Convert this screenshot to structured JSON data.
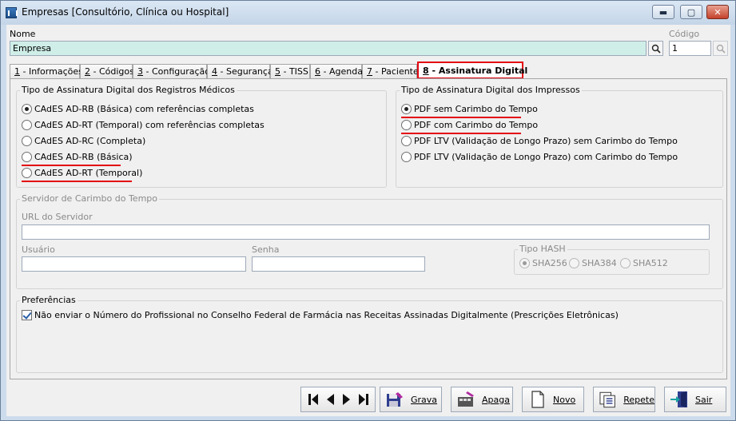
{
  "window": {
    "title": "Empresas [Consultório, Clínica ou Hospital]",
    "controls": {
      "minimize": "▬",
      "maximize": "▢",
      "close": "✕"
    }
  },
  "header": {
    "name_label": "Nome",
    "name_value": "Empresa",
    "code_label": "Código",
    "code_value": "1"
  },
  "tabs": [
    {
      "num": "1",
      "label": " - Informações"
    },
    {
      "num": "2",
      "label": " - Códigos"
    },
    {
      "num": "3",
      "label": " - Configuração"
    },
    {
      "num": "4",
      "label": " - Segurança"
    },
    {
      "num": "5",
      "label": " - TISS"
    },
    {
      "num": "6",
      "label": " - Agenda"
    },
    {
      "num": "7",
      "label": " - Paciente"
    },
    {
      "num": "8",
      "label": " - Assinatura Digital"
    }
  ],
  "registros": {
    "title": "Tipo de Assinatura Digital dos Registros Médicos",
    "options": [
      "CAdES AD-RB (Básica) com referências completas",
      "CAdES AD-RT (Temporal) com referências completas",
      "CAdES AD-RC (Completa)",
      "CAdES AD-RB (Básica)",
      "CAdES AD-RT (Temporal)"
    ]
  },
  "impressos": {
    "title": "Tipo de Assinatura Digital dos Impressos",
    "options": [
      "PDF sem Carimbo do Tempo",
      "PDF com Carimbo do Tempo",
      "PDF LTV (Validação de Longo Prazo) sem Carimbo do Tempo",
      "PDF LTV (Validação de Longo Prazo) com Carimbo do Tempo"
    ]
  },
  "servidor": {
    "title": "Servidor de Carimbo do Tempo",
    "url_label": "URL do Servidor",
    "url_value": "",
    "user_label": "Usuário",
    "user_value": "",
    "pass_label": "Senha",
    "pass_value": "",
    "hash_label": "Tipo HASH",
    "hash_options": [
      "SHA256",
      "SHA384",
      "SHA512"
    ]
  },
  "preferencias": {
    "title": "Preferências",
    "checkbox_label": "Não enviar o Número do Profissional no Conselho Federal de Farmácia nas Receitas Assinadas Digitalmente (Prescrições Eletrônicas)"
  },
  "actions": {
    "grava": "Grava",
    "apaga": "Apaga",
    "novo": "Novo",
    "repete": "Repete",
    "sair": "Sair"
  },
  "colors": {
    "highlight": "#e30613",
    "name_field_bg": "#cfeee8",
    "window_frame": "#cddcec"
  }
}
